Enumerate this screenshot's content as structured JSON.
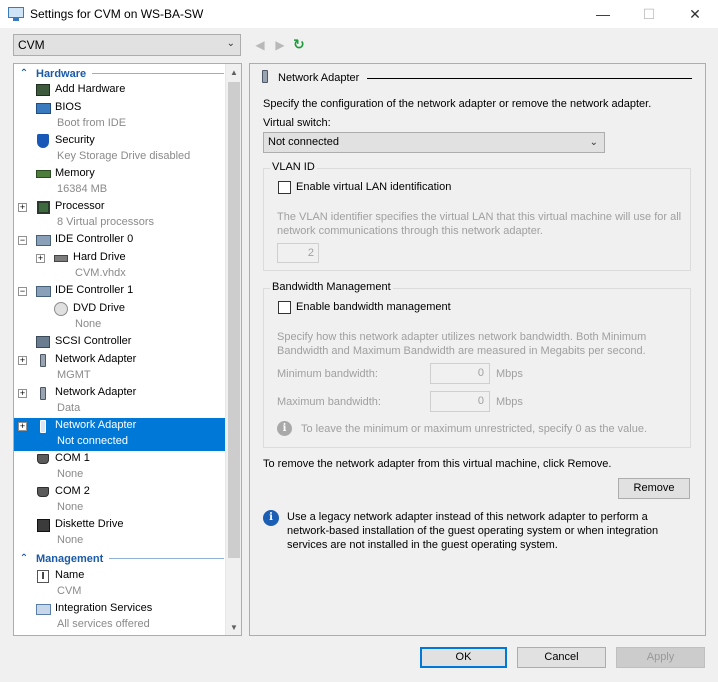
{
  "window": {
    "title": "Settings for CVM on WS-BA-SW",
    "minimize_icon": "minimize-icon",
    "maximize_icon": "maximize-icon",
    "close_icon": "close-icon"
  },
  "toolbar": {
    "vm_selected": "CVM"
  },
  "tree": {
    "hardware_label": "Hardware",
    "management_label": "Management",
    "items": [
      {
        "name": "Add Hardware",
        "sub": ""
      },
      {
        "name": "BIOS",
        "sub": "Boot from IDE"
      },
      {
        "name": "Security",
        "sub": "Key Storage Drive disabled"
      },
      {
        "name": "Memory",
        "sub": "16384 MB"
      },
      {
        "name": "Processor",
        "sub": "8 Virtual processors"
      },
      {
        "name": "IDE Controller 0",
        "sub": ""
      },
      {
        "name": "Hard Drive",
        "sub": "CVM.vhdx"
      },
      {
        "name": "IDE Controller 1",
        "sub": ""
      },
      {
        "name": "DVD Drive",
        "sub": "None"
      },
      {
        "name": "SCSI Controller",
        "sub": ""
      },
      {
        "name": "Network Adapter",
        "sub": "MGMT"
      },
      {
        "name": "Network Adapter",
        "sub": "Data"
      },
      {
        "name": "Network Adapter",
        "sub": "Not connected"
      },
      {
        "name": "COM 1",
        "sub": "None"
      },
      {
        "name": "COM 2",
        "sub": "None"
      },
      {
        "name": "Diskette Drive",
        "sub": "None"
      }
    ],
    "mgmt_items": [
      {
        "name": "Name",
        "sub": "CVM"
      },
      {
        "name": "Integration Services",
        "sub": "All services offered"
      }
    ]
  },
  "panel": {
    "title": "Network Adapter",
    "description": "Specify the configuration of the network adapter or remove the network adapter.",
    "virtual_switch_label": "Virtual switch:",
    "virtual_switch_value": "Not connected",
    "vlan": {
      "legend": "VLAN ID",
      "checkbox_label": "Enable virtual LAN identification",
      "help_line1": "The VLAN identifier specifies the virtual LAN that this virtual machine will use for all",
      "help_line2": "network communications through this network adapter.",
      "value": "2"
    },
    "bandwidth": {
      "legend": "Bandwidth Management",
      "checkbox_label": "Enable bandwidth management",
      "help_line1": "Specify how this network adapter utilizes network bandwidth. Both Minimum",
      "help_line2": "Bandwidth and Maximum Bandwidth are measured in Megabits per second.",
      "min_label": "Minimum bandwidth:",
      "min_value": "0",
      "max_label": "Maximum bandwidth:",
      "max_value": "0",
      "unit": "Mbps",
      "note": "To leave the minimum or maximum unrestricted, specify 0 as the value."
    },
    "remove_text": "To remove the network adapter from this virtual machine, click Remove.",
    "remove_button": "Remove",
    "legacy_line1": "Use a legacy network adapter instead of this network adapter to perform a",
    "legacy_line2": "network-based installation of the guest operating system or when integration",
    "legacy_line3": "services are not installed in the guest operating system."
  },
  "footer": {
    "ok": "OK",
    "cancel": "Cancel",
    "apply": "Apply"
  }
}
